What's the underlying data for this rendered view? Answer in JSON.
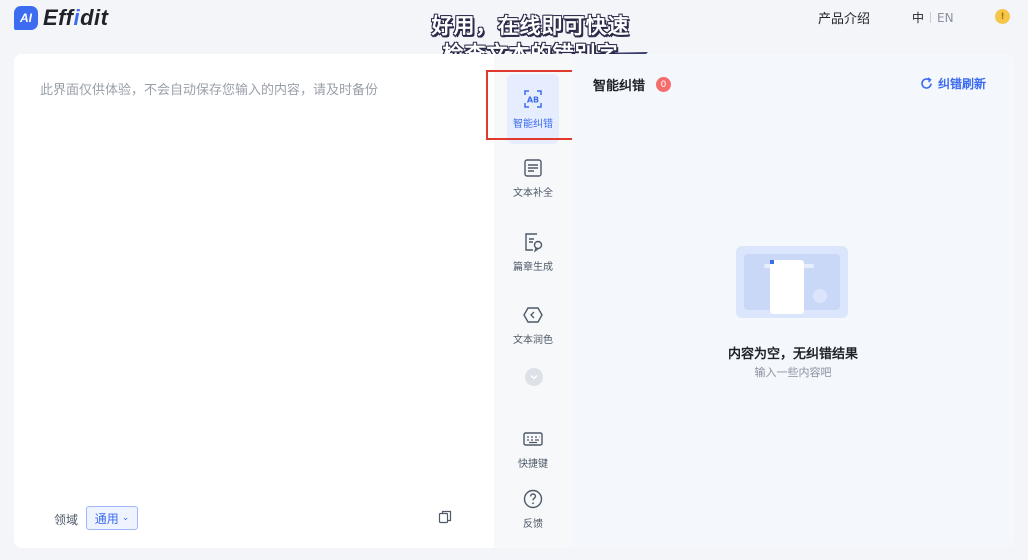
{
  "header": {
    "logo_badge": "AI",
    "logo_pre": "Eff",
    "logo_accent": "i",
    "logo_post": "dit",
    "nav_intro": "产品介绍",
    "lang_zh": "中",
    "lang_en": "EN",
    "tip_icon": "lightbulb-icon"
  },
  "caption": {
    "line1": "好用，在线即可快速",
    "line2": "检查文本的错别字"
  },
  "editor": {
    "placeholder": "此界面仅供体验，不会自动保存您输入的内容，请及时备份",
    "domain_label": "领域",
    "domain_value": "通用"
  },
  "tools": [
    {
      "label": "智能纠错",
      "icon": "ab-scan-icon",
      "active": true
    },
    {
      "label": "文本补全",
      "icon": "document-lines-icon"
    },
    {
      "label": "篇章生成",
      "icon": "document-pen-icon"
    },
    {
      "label": "文本润色",
      "icon": "tag-diamond-icon"
    },
    {
      "label": "快捷键",
      "icon": "keyboard-icon"
    },
    {
      "label": "反馈",
      "icon": "question-circle-icon"
    }
  ],
  "results": {
    "title": "智能纠错",
    "count": "0",
    "refresh_label": "纠错刷新",
    "empty_title": "内容为空，无纠错结果",
    "empty_sub": "输入一些内容吧"
  },
  "colors": {
    "accent": "#3d6cf0",
    "badge_red": "#f56c6c",
    "highlight_red": "#e2392e"
  }
}
